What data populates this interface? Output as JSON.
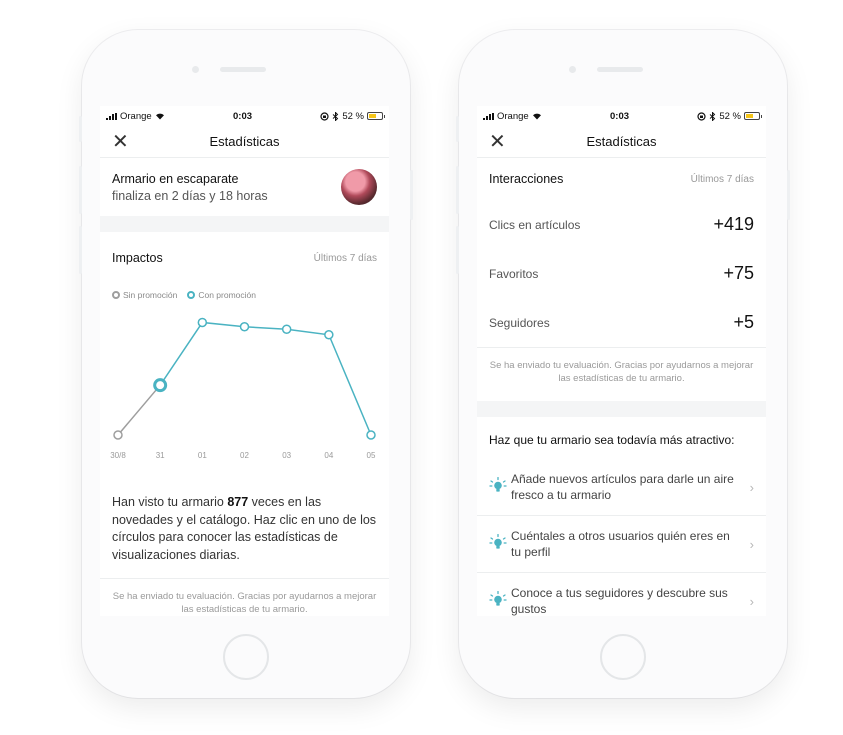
{
  "status": {
    "carrier": "Orange",
    "time": "0:03",
    "battery": "52 %"
  },
  "left": {
    "title": "Estadísticas",
    "promo": {
      "title": "Armario en escaparate",
      "subtitle": "finaliza en 2 días y 18 horas"
    },
    "impacts": {
      "heading": "Impactos",
      "period": "Últimos 7 días",
      "legend_without": "Sin promoción",
      "legend_with": "Con promoción"
    },
    "desc": {
      "before": "Han visto tu armario ",
      "count": "877",
      "after": " veces en las novedades y el catálogo. Haz clic en uno de los círculos para conocer las estadísticas de visualizaciones diarias."
    },
    "note": "Se ha enviado tu evaluación. Gracias por ayudarnos a mejorar las estadísticas de tu armario."
  },
  "right": {
    "title": "Estadísticas",
    "interactions": {
      "heading": "Interacciones",
      "period": "Últimos 7 días"
    },
    "stats": [
      {
        "label": "Clics en artículos",
        "value": "+419"
      },
      {
        "label": "Favoritos",
        "value": "+75"
      },
      {
        "label": "Seguidores",
        "value": "+5"
      }
    ],
    "note": "Se ha enviado tu evaluación. Gracias por ayudarnos a mejorar las estadísticas de tu armario.",
    "tips_title": "Haz que tu armario sea todavía más atractivo:",
    "tips": [
      "Añade nuevos artículos para darle un aire fresco a tu armario",
      "Cuéntales a otros usuarios quién eres en tu perfil",
      "Conoce a tus seguidores y descubre sus gustos"
    ]
  },
  "colors": {
    "accent": "#4ab3c2",
    "gray_series": "#9e9e9e"
  },
  "chart_data": {
    "type": "line",
    "categories": [
      "30/8",
      "31",
      "01",
      "02",
      "03",
      "04",
      "05"
    ],
    "series": [
      {
        "name": "Sin promoción",
        "values": [
          0,
          81,
          null,
          null,
          null,
          null,
          null
        ]
      },
      {
        "name": "Con promoción",
        "values": [
          null,
          81,
          183,
          176,
          172,
          163,
          0
        ]
      }
    ],
    "ylim": [
      0,
      200
    ],
    "selected_index": 1,
    "grid": false
  }
}
